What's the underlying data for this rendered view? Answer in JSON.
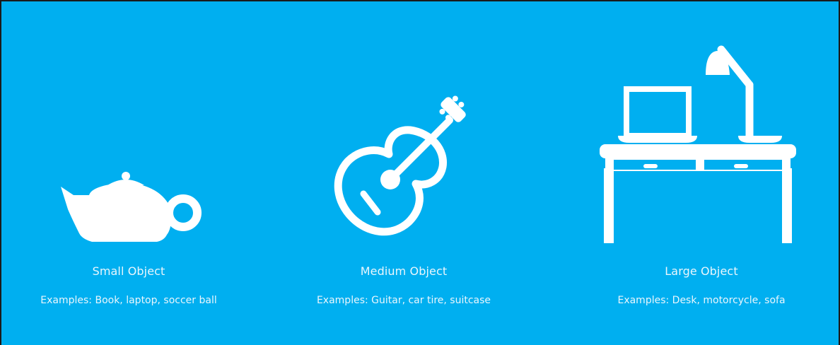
{
  "colors": {
    "background": "#00aff0",
    "foreground": "#ffffff",
    "text": "#e9f6fd",
    "border": "#1a1a1a"
  },
  "options": [
    {
      "id": "small",
      "icon": "teapot-icon",
      "title": "Small Object",
      "examples": "Examples: Book, laptop, soccer ball"
    },
    {
      "id": "medium",
      "icon": "guitar-icon",
      "title": "Medium Object",
      "examples": "Examples: Guitar, car tire, suitcase"
    },
    {
      "id": "large",
      "icon": "desk-icon",
      "title": "Large Object",
      "examples": "Examples: Desk, motorcycle, sofa"
    }
  ]
}
